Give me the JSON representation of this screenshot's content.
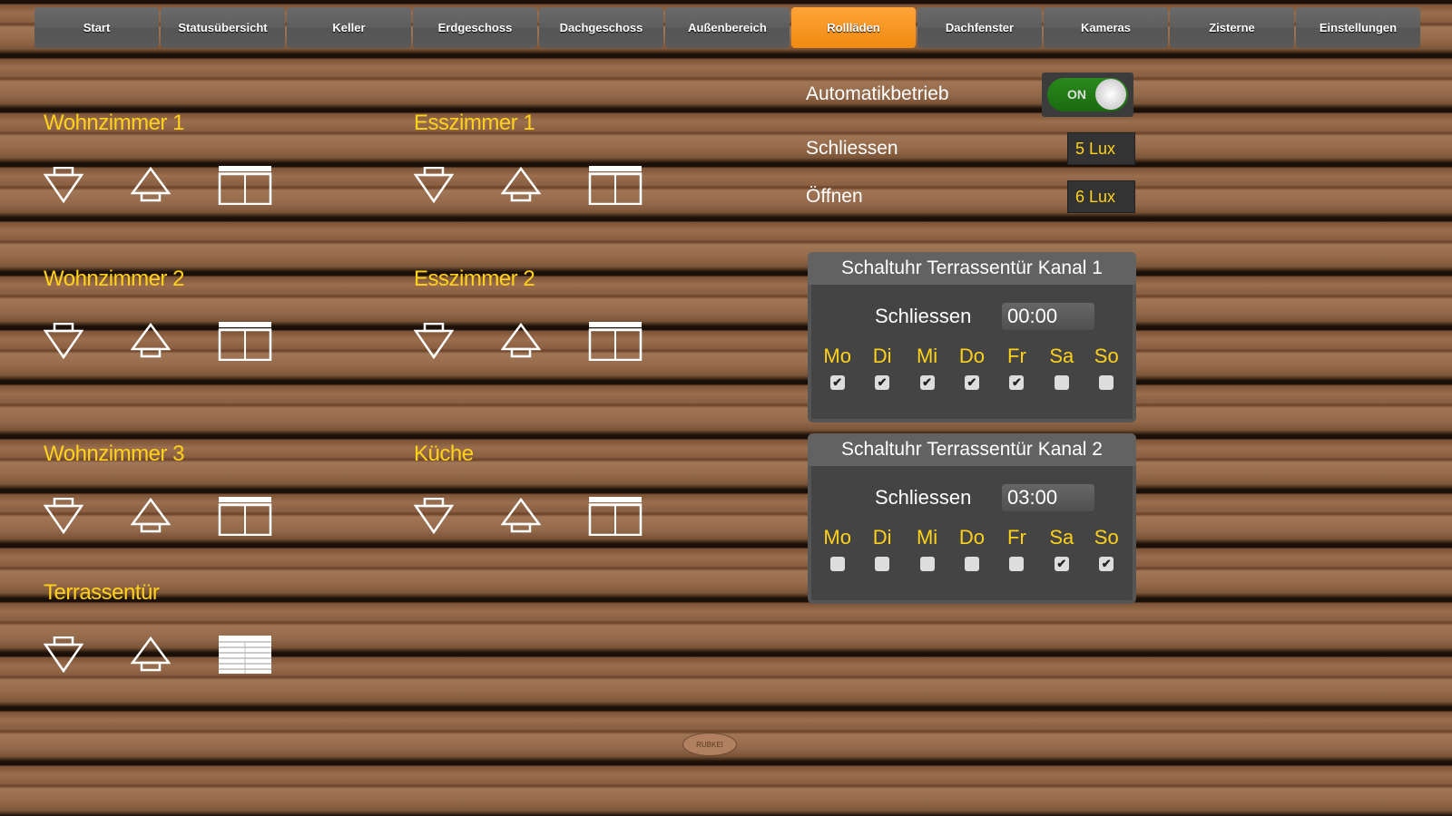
{
  "nav": {
    "tabs": [
      "Start",
      "Statusübersicht",
      "Keller",
      "Erdgeschoss",
      "Dachgeschoss",
      "Außenbereich",
      "Rollläden",
      "Dachfenster",
      "Kameras",
      "Zisterne",
      "Einstellungen"
    ],
    "active": "Rollläden"
  },
  "rooms": [
    {
      "name": "Wohnzimmer 1",
      "state": "window-icon"
    },
    {
      "name": "Esszimmer 1",
      "state": "window-icon"
    },
    {
      "name": "Wohnzimmer 2",
      "state": "window-icon"
    },
    {
      "name": "Esszimmer 2",
      "state": "window-icon"
    },
    {
      "name": "Wohnzimmer 3",
      "state": "window-icon"
    },
    {
      "name": "Küche",
      "state": "window-icon"
    },
    {
      "name": "Terrassentür",
      "state": "shutter-closed-icon"
    }
  ],
  "auto": {
    "label": "Automatikbetrieb",
    "toggle": "ON",
    "close_label": "Schliessen",
    "close_value": "5 Lux",
    "open_label": "Öffnen",
    "open_value": "6 Lux"
  },
  "timers": [
    {
      "title": "Schaltuhr Terrassentür Kanal 1",
      "label": "Schliessen",
      "time": "00:00",
      "days": [
        "Mo",
        "Di",
        "Mi",
        "Do",
        "Fr",
        "Sa",
        "So"
      ],
      "checked": [
        true,
        true,
        true,
        true,
        true,
        false,
        false
      ]
    },
    {
      "title": "Schaltuhr Terrassentür Kanal 2",
      "label": "Schliessen",
      "time": "03:00",
      "days": [
        "Mo",
        "Di",
        "Mi",
        "Do",
        "Fr",
        "Sa",
        "So"
      ],
      "checked": [
        false,
        false,
        false,
        false,
        false,
        true,
        true
      ]
    }
  ],
  "colors": {
    "accent": "#f5961e",
    "title": "#ffd21a"
  }
}
